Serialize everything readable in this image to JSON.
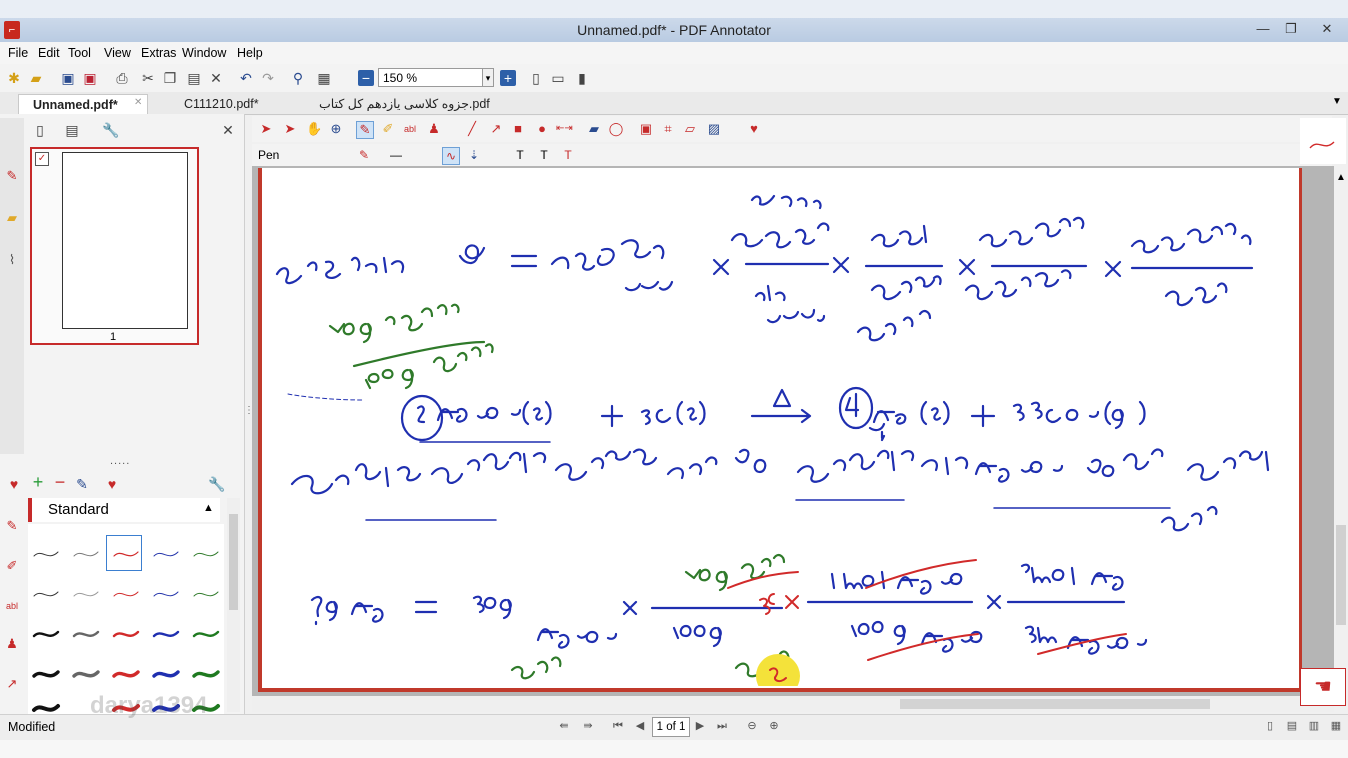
{
  "window": {
    "title": "Unnamed.pdf* - PDF Annotator",
    "app_icon": "pdf-annotator-logo",
    "controls": [
      "minimize-icon",
      "maximize-icon",
      "close-icon"
    ],
    "close_glyph": "✕",
    "min_glyph": "—",
    "max_glyph": "❐"
  },
  "menu": [
    "File",
    "Edit",
    "Tool",
    "View",
    "Extras",
    "Window",
    "Help"
  ],
  "toolbar": {
    "zoom_value": "150 %",
    "zoom_dropdown_glyph": "▾"
  },
  "tabs": [
    {
      "label": "Unnamed.pdf*",
      "active": true
    },
    {
      "label": "C111210.pdf*",
      "active": false
    },
    {
      "label": "جزوه کلاسی یازدهم کل کتاب.pdf",
      "active": false
    }
  ],
  "thumbnails": {
    "page_label": "1",
    "checked": true
  },
  "favorites": {
    "group_title": "Standard",
    "splitter": "....."
  },
  "annotation_toolbar": {
    "tool_name": "Pen",
    "colors": {
      "accent": "#c62a2a",
      "pen_blue": "#1f2fb0",
      "pen_green": "#2f7a2a",
      "pen_red": "#d12a2a",
      "highlight_yellow": "#f4e23a"
    }
  },
  "status": {
    "text": "Modified",
    "page_of": "1 of 1"
  },
  "watermark": "darya1394"
}
